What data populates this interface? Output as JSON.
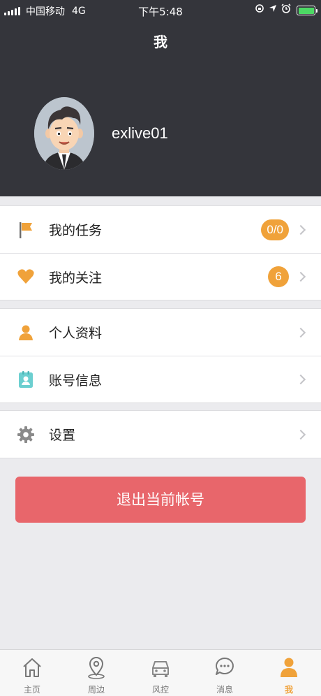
{
  "status_bar": {
    "carrier": "中国移动",
    "network": "4G",
    "time": "下午5:48",
    "battery_color": "#4cd964"
  },
  "header": {
    "title": "我",
    "username": "exlive01",
    "background": "#34353b"
  },
  "sections": [
    {
      "items": [
        {
          "label": "我的任务",
          "icon": "flag-icon",
          "badge": "0/0"
        },
        {
          "label": "我的关注",
          "icon": "heart-icon",
          "badge": "6"
        }
      ]
    },
    {
      "items": [
        {
          "label": "个人资料",
          "icon": "person-icon"
        },
        {
          "label": "账号信息",
          "icon": "id-card-icon"
        }
      ]
    },
    {
      "items": [
        {
          "label": "设置",
          "icon": "gear-icon"
        }
      ]
    }
  ],
  "logout": {
    "label": "退出当前帐号",
    "color": "#e8666b"
  },
  "accent_color": "#f0a23a",
  "tabbar": {
    "tabs": [
      {
        "label": "主页",
        "icon": "home-icon"
      },
      {
        "label": "周边",
        "icon": "location-pin-icon"
      },
      {
        "label": "风控",
        "icon": "car-icon"
      },
      {
        "label": "消息",
        "icon": "message-icon"
      },
      {
        "label": "我",
        "icon": "user-icon",
        "active": true
      }
    ]
  }
}
